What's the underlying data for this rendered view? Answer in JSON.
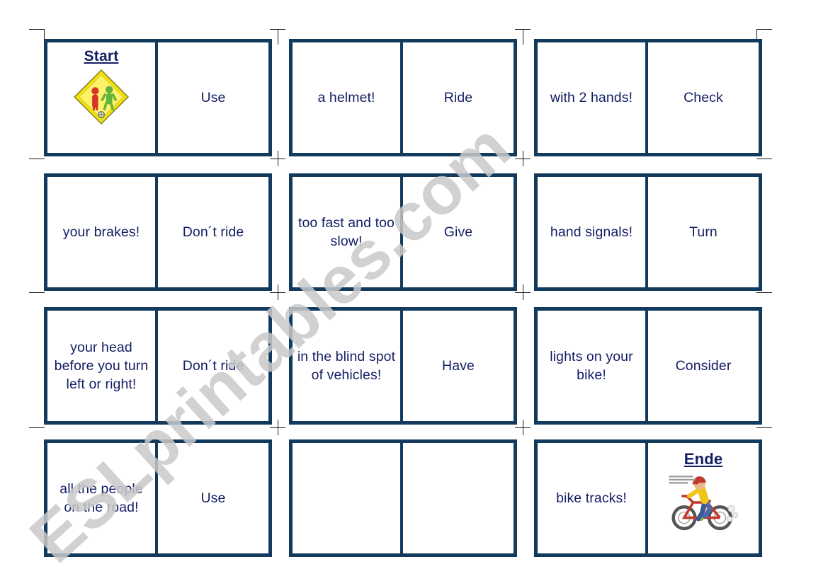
{
  "document": {
    "type": "domino-worksheet",
    "topic": "Road safety / bike rules dominoes",
    "watermark": "ESLprintables.com",
    "colors": {
      "card_border": "#123a5c",
      "text": "#141e64",
      "page_background": "#ffffff",
      "crop_mark": "#1a1a1a",
      "watermark": "#c9c9c9",
      "sign_yellow": "#f5e400",
      "sign_red": "#d8352a",
      "sign_green": "#62b33c"
    }
  },
  "grid": {
    "rows": 4,
    "columns": 3,
    "cells_per_domino": 2
  },
  "dominoes": [
    {
      "row": 1,
      "col": 1,
      "left": {
        "kind": "start",
        "caption": "Start",
        "icon": "road-safety-sign-icon",
        "icon_label": "Road safety"
      },
      "right": {
        "kind": "text",
        "text": "Use"
      }
    },
    {
      "row": 1,
      "col": 2,
      "left": {
        "kind": "text",
        "text": "a helmet!"
      },
      "right": {
        "kind": "text",
        "text": "Ride"
      }
    },
    {
      "row": 1,
      "col": 3,
      "left": {
        "kind": "text",
        "text": "with 2 hands!"
      },
      "right": {
        "kind": "text",
        "text": "Check"
      }
    },
    {
      "row": 2,
      "col": 1,
      "left": {
        "kind": "text",
        "text": "your brakes!"
      },
      "right": {
        "kind": "text",
        "text": "Don´t ride"
      }
    },
    {
      "row": 2,
      "col": 2,
      "left": {
        "kind": "text",
        "text": "too fast and too slow!"
      },
      "right": {
        "kind": "text",
        "text": "Give"
      }
    },
    {
      "row": 2,
      "col": 3,
      "left": {
        "kind": "text",
        "text": "hand signals!"
      },
      "right": {
        "kind": "text",
        "text": "Turn"
      }
    },
    {
      "row": 3,
      "col": 1,
      "left": {
        "kind": "text",
        "text": "your head before you turn left or right!"
      },
      "right": {
        "kind": "text",
        "text": "Don´t ride"
      }
    },
    {
      "row": 3,
      "col": 2,
      "left": {
        "kind": "text",
        "text": "in the blind spot of vehicles!"
      },
      "right": {
        "kind": "text",
        "text": "Have"
      }
    },
    {
      "row": 3,
      "col": 3,
      "left": {
        "kind": "text",
        "text": "lights on your bike!"
      },
      "right": {
        "kind": "text",
        "text": "Consider"
      }
    },
    {
      "row": 4,
      "col": 1,
      "left": {
        "kind": "text",
        "text": "all the people on the road!"
      },
      "right": {
        "kind": "text",
        "text": "Use"
      }
    },
    {
      "row": 4,
      "col": 2,
      "left": {
        "kind": "text",
        "text": ""
      },
      "right": {
        "kind": "text",
        "text": ""
      }
    },
    {
      "row": 4,
      "col": 3,
      "left": {
        "kind": "text",
        "text": "bike tracks!"
      },
      "right": {
        "kind": "end",
        "caption": "Ende",
        "icon": "cyclist-cartoon-icon"
      }
    }
  ]
}
